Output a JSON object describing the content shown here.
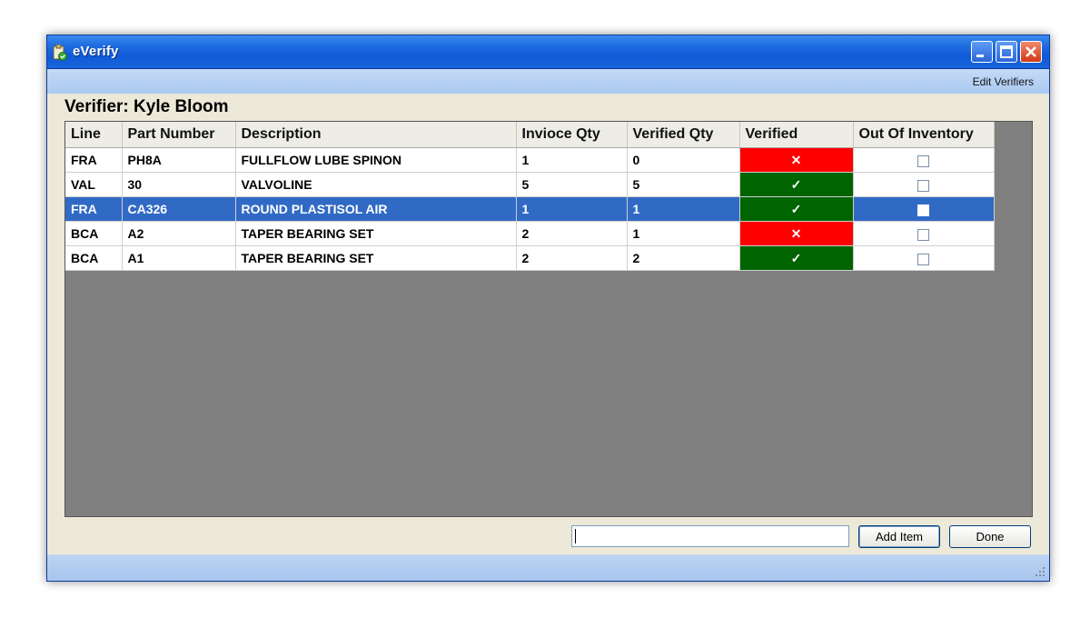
{
  "window": {
    "title": "eVerify",
    "colors": {
      "titlebar": "#1f6de0",
      "menubar": "#aac9f1",
      "selection": "#316ac5",
      "not_verified": "#ff0000",
      "verified": "#006400"
    }
  },
  "menu": {
    "edit_verifiers": "Edit Verifiers"
  },
  "verifier_label": "Verifier: Kyle Bloom",
  "grid": {
    "columns": [
      "Line",
      "Part Number",
      "Description",
      "Invioce Qty",
      "Verified Qty",
      "Verified",
      "Out Of Inventory"
    ],
    "rows": [
      {
        "line": "FRA",
        "part": "PH8A",
        "desc": "FULLFLOW LUBE SPINON",
        "inv_qty": "1",
        "ver_qty": "0",
        "verified": "✕",
        "verified_status": "not-verified",
        "out_of_inventory": false,
        "selected": false
      },
      {
        "line": "VAL",
        "part": "30",
        "desc": "VALVOLINE",
        "inv_qty": "5",
        "ver_qty": "5",
        "verified": "✓",
        "verified_status": "verified",
        "out_of_inventory": false,
        "selected": false
      },
      {
        "line": "FRA",
        "part": "CA326",
        "desc": "ROUND PLASTISOL AIR",
        "inv_qty": "1",
        "ver_qty": "1",
        "verified": "✓",
        "verified_status": "verified",
        "out_of_inventory": false,
        "selected": true
      },
      {
        "line": "BCA",
        "part": "A2",
        "desc": "TAPER BEARING SET",
        "inv_qty": "2",
        "ver_qty": "1",
        "verified": "✕",
        "verified_status": "not-verified",
        "out_of_inventory": false,
        "selected": false
      },
      {
        "line": "BCA",
        "part": "A1",
        "desc": "TAPER BEARING SET",
        "inv_qty": "2",
        "ver_qty": "2",
        "verified": "✓",
        "verified_status": "verified",
        "out_of_inventory": false,
        "selected": false
      }
    ]
  },
  "item_input": {
    "value": "",
    "placeholder": ""
  },
  "buttons": {
    "add_item": "Add Item",
    "done": "Done"
  },
  "icons": {
    "app": "clipboard-check-icon",
    "minimize": "minimize-icon",
    "maximize": "maximize-icon",
    "close": "close-icon",
    "resize": "resize-grip-icon"
  }
}
